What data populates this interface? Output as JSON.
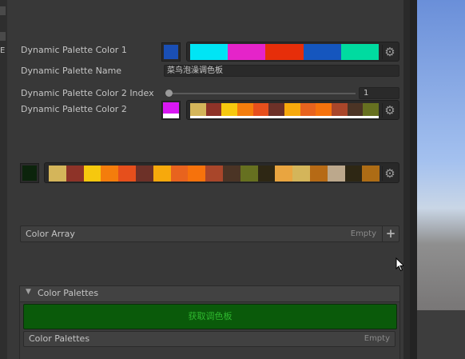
{
  "left_strip": {
    "letter": "E"
  },
  "inspector": {
    "color1": {
      "label": "Dynamic Palette Color 1",
      "swatch": "#1a4fb5",
      "palette": [
        "#00e5f5",
        "#e524c9",
        "#e62e0a",
        "#1556be",
        "#00dba0"
      ]
    },
    "name": {
      "label": "Dynamic Palette Name",
      "value": "菜鸟泡澡调色板"
    },
    "index": {
      "label": "Dynamic Palette Color 2 Index",
      "value": "1",
      "slider_fraction": 0.0
    },
    "color2": {
      "label": "Dynamic Palette Color 2",
      "swatch": "#d818f2",
      "palette": [
        "#d4b55a",
        "#8e3328",
        "#f6c80e",
        "#f47d0c",
        "#e64f1c",
        "#6d3128",
        "#f7a90c",
        "#e8631e",
        "#f6720c",
        "#a9462a",
        "#4b3425",
        "#667020"
      ]
    },
    "big_palette": {
      "swatch": "#0c240c",
      "palette": [
        "#d4b55a",
        "#8e3328",
        "#f6c80e",
        "#f47d0c",
        "#e64f1c",
        "#6d3128",
        "#f7a90c",
        "#e8631e",
        "#f6720c",
        "#a9462a",
        "#4b3425",
        "#667020",
        "#2e2714",
        "#e9a540",
        "#d4b55a",
        "#b66a15",
        "#bca88c",
        "#2e2714",
        "#ad6c15"
      ]
    },
    "color_array": {
      "title": "Color Array",
      "empty": "Empty"
    },
    "color_palettes": {
      "header": "Color Palettes",
      "fetch_button": "获取调色板",
      "inner_title": "Color Palettes",
      "empty": "Empty"
    }
  },
  "icons": {
    "gear": "gear-icon",
    "add": "plus-icon",
    "foldout": "triangle-down-icon",
    "cursor": "mouse-cursor-icon"
  },
  "colors": {
    "panel_bg": "#383838",
    "fetch_button_bg": "#0a5a0a",
    "fetch_button_text": "#2fb82f"
  }
}
